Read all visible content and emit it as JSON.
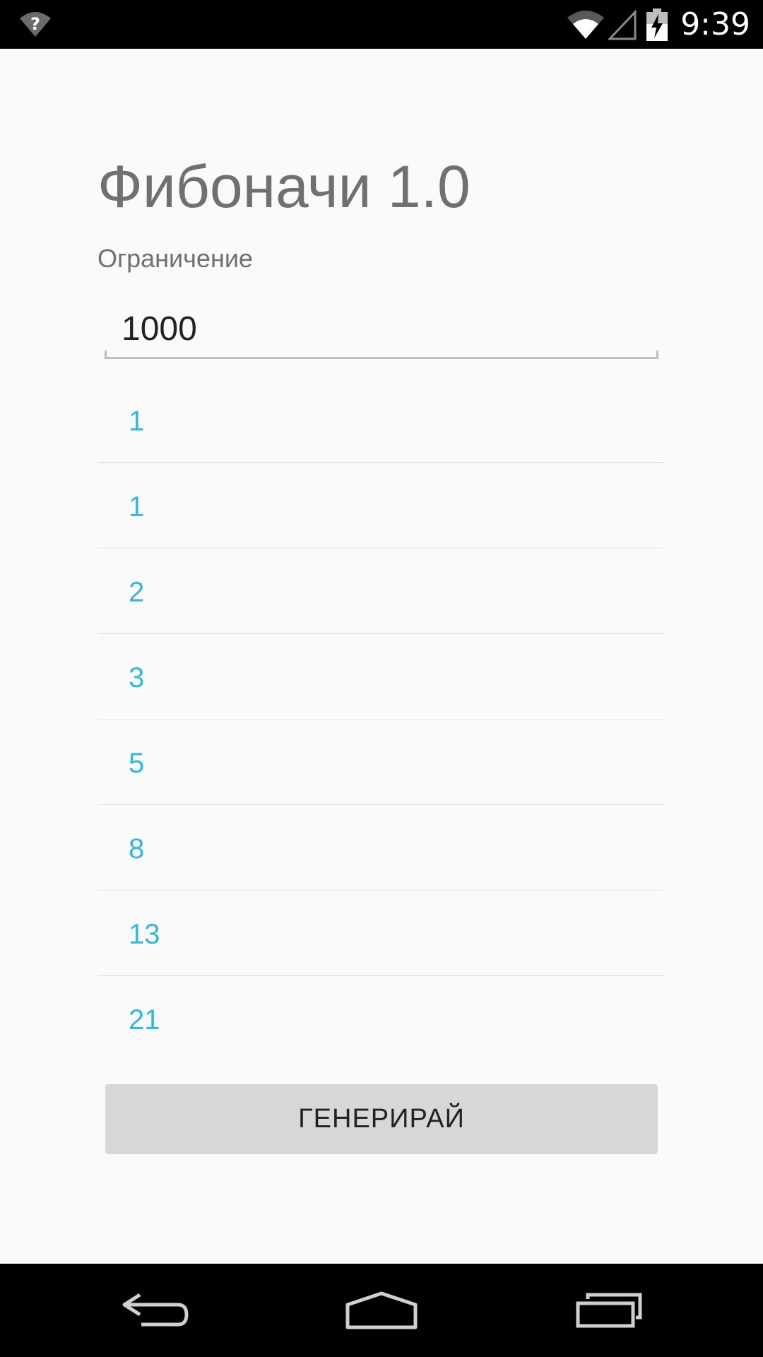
{
  "status_bar": {
    "time": "9:39",
    "icons": [
      "wifi-unknown-icon",
      "wifi-icon",
      "signal-icon",
      "battery-charging-icon"
    ]
  },
  "app": {
    "title": "Фибоначи 1.0",
    "limit_label": "Ограничение",
    "limit_value": "1000",
    "sequence": [
      "1",
      "1",
      "2",
      "3",
      "5",
      "8",
      "13",
      "21"
    ],
    "generate_label": "ГЕНЕРИРАЙ"
  },
  "colors": {
    "accent": "#33b5e5",
    "button_bg": "#d6d7d7",
    "title_text": "#707070",
    "background": "#fafafa"
  },
  "nav_bar": {
    "icons": [
      "back-icon",
      "home-icon",
      "recents-icon"
    ]
  }
}
